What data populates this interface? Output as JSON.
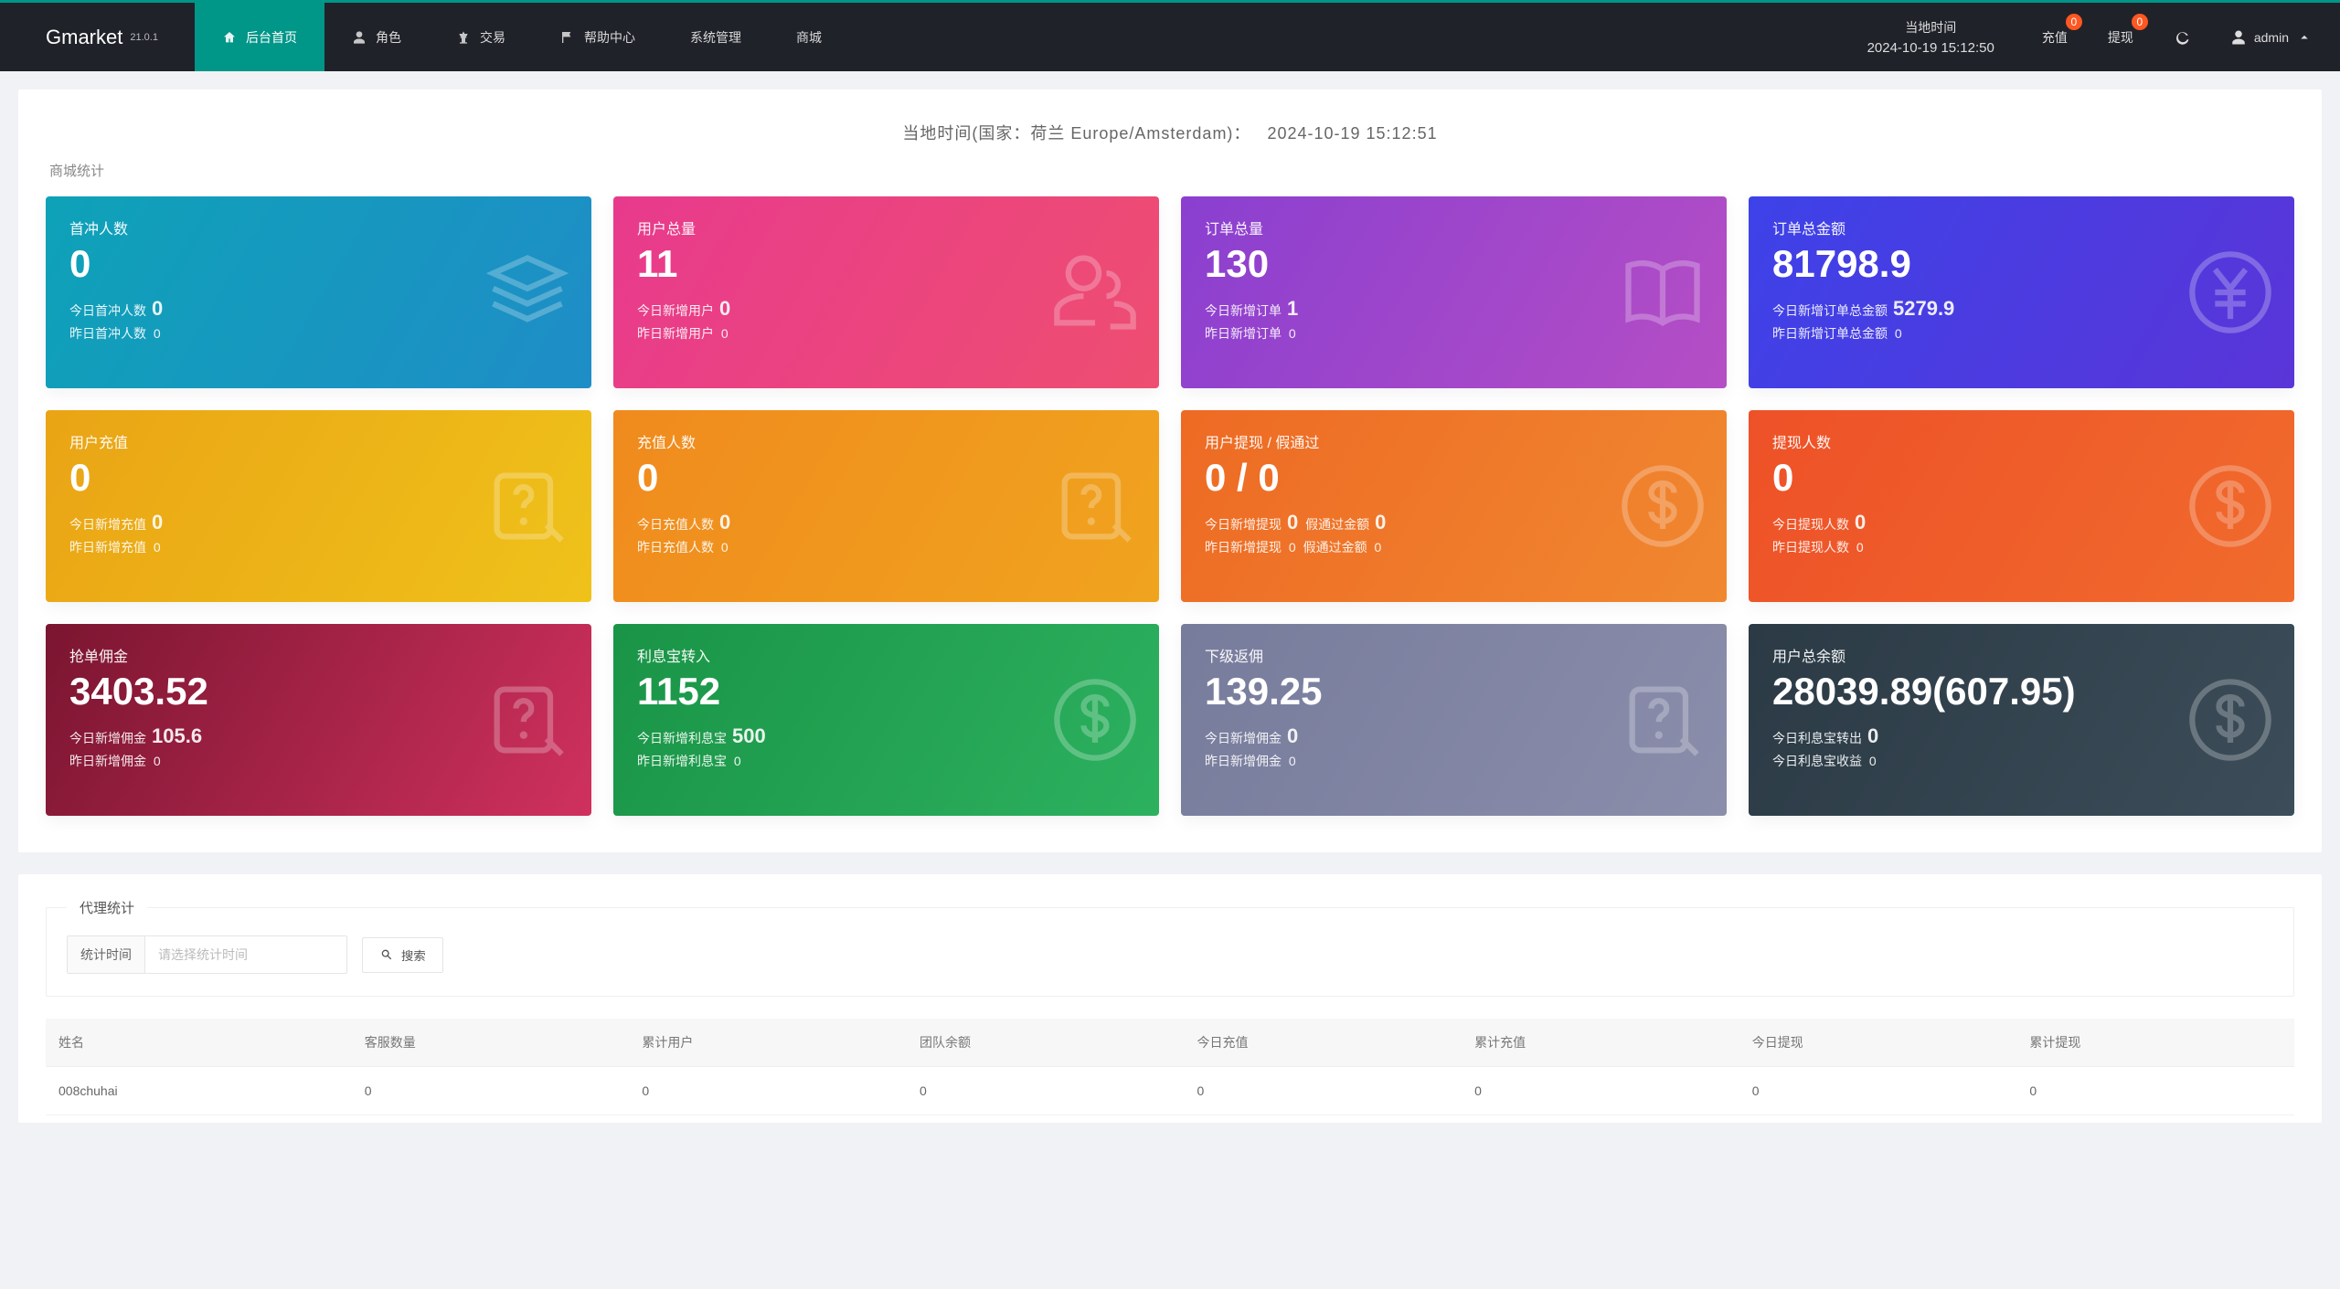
{
  "brand": {
    "name": "Gmarket",
    "version": "21.0.1"
  },
  "nav": {
    "items": [
      {
        "label": "后台首页",
        "active": true,
        "icon": "home"
      },
      {
        "label": "角色",
        "icon": "user"
      },
      {
        "label": "交易",
        "icon": "scale"
      },
      {
        "label": "帮助中心",
        "icon": "flag"
      },
      {
        "label": "系统管理",
        "icon": ""
      },
      {
        "label": "商城",
        "icon": ""
      }
    ]
  },
  "header_clock": {
    "label": "当地时间",
    "value": "2024-10-19 15:12:50"
  },
  "header_actions": {
    "recharge": {
      "label": "充值",
      "badge": "0"
    },
    "withdraw": {
      "label": "提现",
      "badge": "0"
    },
    "user": "admin"
  },
  "local_time": {
    "prefix": "当地时间(国家：荷兰 Europe/Amsterdam)：",
    "value": "2024-10-19 15:12:51"
  },
  "section_titles": {
    "mall": "商城统计",
    "agent": "代理统计"
  },
  "filter": {
    "label": "统计时间",
    "placeholder": "请选择统计时间",
    "search": "搜索"
  },
  "cards": [
    {
      "title": "首冲人数",
      "big": "0",
      "r1_label": "今日首冲人数",
      "r1_val": "0",
      "r2_label": "昨日首冲人数",
      "r2_val": "0",
      "grad": "g-blue",
      "icon": "layers"
    },
    {
      "title": "用户总量",
      "big": "11",
      "r1_label": "今日新增用户",
      "r1_val": "0",
      "r2_label": "昨日新增用户",
      "r2_val": "0",
      "grad": "g-pink",
      "icon": "users"
    },
    {
      "title": "订单总量",
      "big": "130",
      "r1_label": "今日新增订单",
      "r1_val": "1",
      "r2_label": "昨日新增订单",
      "r2_val": "0",
      "grad": "g-purple",
      "icon": "book"
    },
    {
      "title": "订单总金额",
      "big": "81798.9",
      "r1_label": "今日新增订单总金额",
      "r1_val": "5279.9",
      "r2_label": "昨日新增订单总金额",
      "r2_val": "0",
      "grad": "g-indigo",
      "icon": "yen"
    },
    {
      "title": "用户充值",
      "big": "0",
      "r1_label": "今日新增充值",
      "r1_val": "0",
      "r2_label": "昨日新增充值",
      "r2_val": "0",
      "grad": "g-yellow",
      "icon": "question"
    },
    {
      "title": "充值人数",
      "big": "0",
      "r1_label": "今日充值人数",
      "r1_val": "0",
      "r2_label": "昨日充值人数",
      "r2_val": "0",
      "grad": "g-orange",
      "icon": "question"
    },
    {
      "title": "用户提现 / 假通过",
      "big": "0 / 0",
      "r1_label": "今日新增提现",
      "r1_val": "0",
      "r1_label2": "假通过金额",
      "r1_val2": "0",
      "r2_label": "昨日新增提现",
      "r2_val": "0",
      "r2_label2": "假通过金额",
      "r2_val2": "0",
      "grad": "g-deeporange",
      "icon": "dollar"
    },
    {
      "title": "提现人数",
      "big": "0",
      "r1_label": "今日提现人数",
      "r1_val": "0",
      "r2_label": "昨日提现人数",
      "r2_val": "0",
      "grad": "g-redorange",
      "icon": "dollar"
    },
    {
      "title": "抢单佣金",
      "big": "3403.52",
      "r1_label": "今日新增佣金",
      "r1_val": "105.6",
      "r2_label": "昨日新增佣金",
      "r2_val": "0",
      "grad": "g-wine",
      "icon": "question"
    },
    {
      "title": "利息宝转入",
      "big": "1152",
      "r1_label": "今日新增利息宝",
      "r1_val": "500",
      "r2_label": "昨日新增利息宝",
      "r2_val": "0",
      "grad": "g-green",
      "icon": "dollar"
    },
    {
      "title": "下级返佣",
      "big": "139.25",
      "r1_label": "今日新增佣金",
      "r1_val": "0",
      "r2_label": "昨日新增佣金",
      "r2_val": "0",
      "grad": "g-greyblue",
      "icon": "question"
    },
    {
      "title": "用户总余额",
      "big": "28039.89(607.95)",
      "r1_label": "今日利息宝转出",
      "r1_val": "0",
      "r2_label": "今日利息宝收益",
      "r2_val": "0",
      "grad": "g-dark",
      "icon": "dollar"
    }
  ],
  "table": {
    "headers": [
      "姓名",
      "客服数量",
      "累计用户",
      "团队余额",
      "今日充值",
      "累计充值",
      "今日提现",
      "累计提现"
    ],
    "rows": [
      [
        "008chuhai",
        "0",
        "0",
        "0",
        "0",
        "0",
        "0",
        "0"
      ]
    ]
  }
}
